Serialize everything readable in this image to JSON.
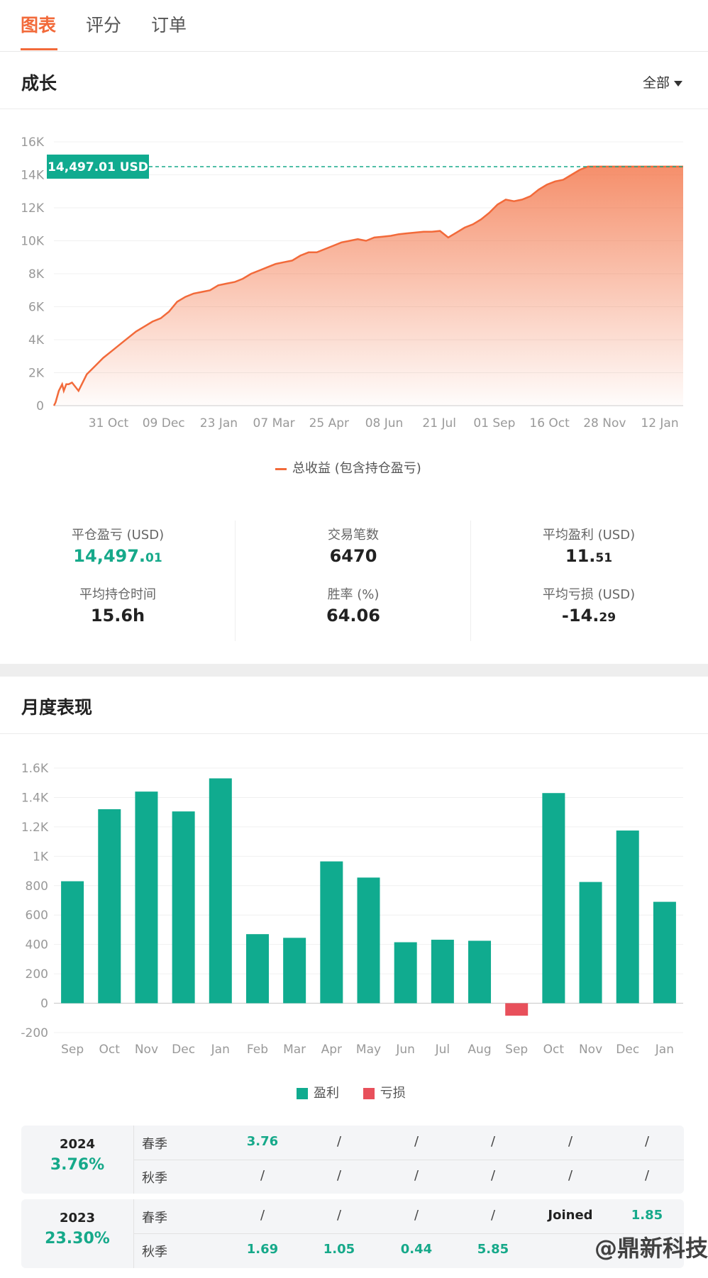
{
  "tabs": [
    {
      "label": "图表",
      "active": true
    },
    {
      "label": "评分",
      "active": false
    },
    {
      "label": "订单",
      "active": false
    }
  ],
  "growth": {
    "title": "成长",
    "filter": "全部",
    "current_label": "14,497.01 USD",
    "legend": "总收益 (包含持仓盈亏)"
  },
  "stats": {
    "closed_pnl": {
      "label": "平仓盈亏 (USD)",
      "int": "14,497.",
      "dec": "01"
    },
    "trades": {
      "label": "交易笔数",
      "value": "6470"
    },
    "avg_profit": {
      "label": "平均盈利 (USD)",
      "int": "11.",
      "dec": "51"
    },
    "avg_hold": {
      "label": "平均持仓时间",
      "value": "15.6h"
    },
    "win_rate": {
      "label": "胜率 (%)",
      "value": "64.06"
    },
    "avg_loss": {
      "label": "平均亏损 (USD)",
      "int": "-14.",
      "dec": "29"
    }
  },
  "monthly": {
    "title": "月度表现",
    "legend_profit": "盈利",
    "legend_loss": "亏损"
  },
  "chart_data": [
    {
      "type": "area",
      "yticks": [
        "0",
        "2K",
        "4K",
        "6K",
        "8K",
        "10K",
        "12K",
        "14K",
        "16K"
      ],
      "ylim": [
        0,
        16000
      ],
      "xticks": [
        "31 Oct",
        "09 Dec",
        "23 Jan",
        "07 Mar",
        "25 Apr",
        "08 Jun",
        "21 Jul",
        "01 Sep",
        "16 Oct",
        "28 Nov",
        "12 Jan"
      ],
      "series": [
        {
          "name": "总收益 (包含持仓盈亏)",
          "x": [
            0,
            2,
            6,
            10,
            12,
            15,
            18,
            22,
            30,
            40,
            50,
            60,
            70,
            85,
            100,
            110,
            120,
            130,
            140,
            150,
            160,
            170,
            180,
            190,
            200,
            210,
            220,
            230,
            240,
            250,
            260,
            270,
            280,
            290,
            300,
            310,
            320,
            330,
            340,
            350,
            360,
            370,
            380,
            390,
            400,
            410,
            420,
            430,
            440,
            450,
            460,
            470,
            480,
            490,
            500,
            510,
            520,
            530,
            540,
            550,
            560,
            570,
            580,
            590,
            600,
            610,
            620,
            630,
            640,
            650,
            660,
            670,
            680,
            690,
            700,
            710,
            720,
            730,
            740,
            750,
            760,
            766
          ],
          "y": [
            0,
            200,
            900,
            1300,
            900,
            1300,
            1300,
            1400,
            900,
            1900,
            2400,
            2900,
            3300,
            3900,
            4500,
            4800,
            5100,
            5300,
            5700,
            6300,
            6600,
            6800,
            6900,
            7000,
            7300,
            7400,
            7500,
            7700,
            8000,
            8200,
            8400,
            8600,
            8700,
            8800,
            9100,
            9300,
            9300,
            9500,
            9700,
            9900,
            10000,
            10100,
            10000,
            10200,
            10250,
            10300,
            10400,
            10450,
            10500,
            10550,
            10550,
            10600,
            10200,
            10500,
            10800,
            11000,
            11300,
            11700,
            12200,
            12500,
            12400,
            12500,
            12700,
            13100,
            13400,
            13600,
            13700,
            14000,
            14300,
            14497,
            14497,
            14497,
            14497,
            14497,
            14497,
            14497,
            14497,
            14497,
            14497,
            14497,
            14497,
            14497
          ],
          "color": "#f26a3a"
        }
      ],
      "annotation": "14,497.01 USD",
      "grid": true,
      "legend": "bottom-center"
    },
    {
      "type": "bar",
      "categories": [
        "Sep",
        "Oct",
        "Nov",
        "Dec",
        "Jan",
        "Feb",
        "Mar",
        "Apr",
        "May",
        "Jun",
        "Jul",
        "Aug",
        "Sep",
        "Oct",
        "Nov",
        "Dec",
        "Jan"
      ],
      "values": [
        830,
        1320,
        1440,
        1305,
        1530,
        470,
        445,
        965,
        855,
        415,
        432,
        425,
        -85,
        1430,
        825,
        1175,
        690
      ],
      "yticks": [
        "-200",
        "0",
        "200",
        "400",
        "600",
        "800",
        "1K",
        "1.2K",
        "1.4K",
        "1.6K"
      ],
      "ylim": [
        -200,
        1600
      ],
      "series": [
        {
          "name": "盈利",
          "color": "#10ab8f"
        },
        {
          "name": "亏损",
          "color": "#e8505b"
        }
      ],
      "grid": true,
      "legend": "bottom-center"
    }
  ],
  "performance": [
    {
      "year": "2024",
      "pct": "3.76%",
      "rows": [
        {
          "season": "春季",
          "cells": [
            "3.76",
            "/",
            "/",
            "/",
            "/",
            "/"
          ]
        },
        {
          "season": "秋季",
          "cells": [
            "/",
            "/",
            "/",
            "/",
            "/",
            "/"
          ]
        }
      ]
    },
    {
      "year": "2023",
      "pct": "23.30%",
      "rows": [
        {
          "season": "春季",
          "cells": [
            "/",
            "/",
            "/",
            "/",
            "Joined",
            "1.85"
          ]
        },
        {
          "season": "秋季",
          "cells": [
            "1.69",
            "1.05",
            "0.44",
            "5.85",
            "",
            ""
          ]
        }
      ]
    }
  ],
  "watermark": "@鼎新科技"
}
